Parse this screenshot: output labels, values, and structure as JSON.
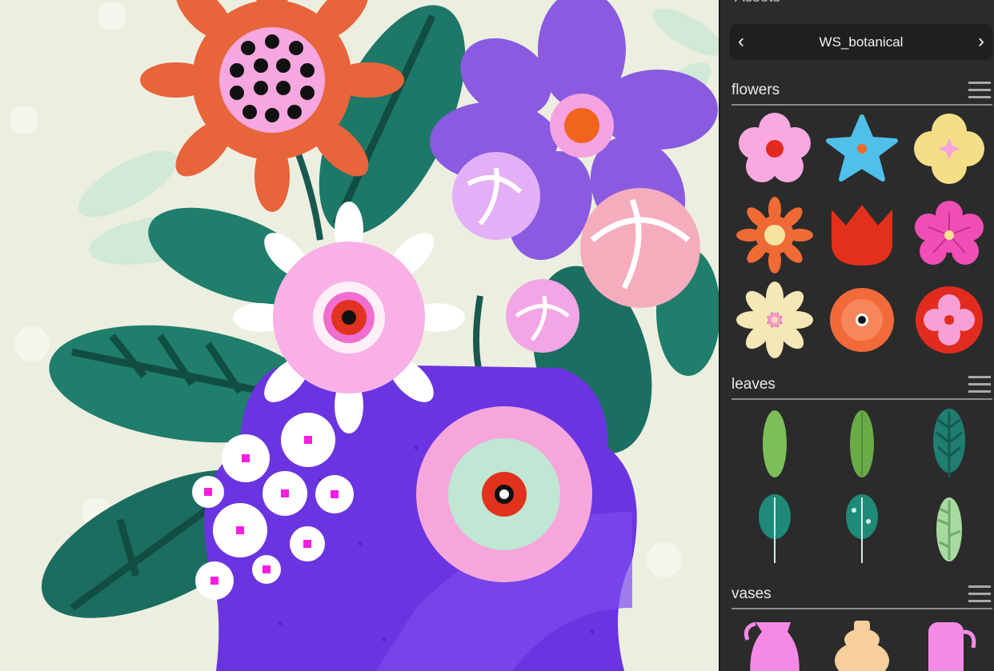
{
  "panel": {
    "title": "Assets",
    "library": {
      "name": "WS_botanical",
      "prev": "‹",
      "next": "›"
    },
    "sections": [
      {
        "title": "flowers",
        "items": [
          "pink-flower-icon",
          "blue-star-flower-icon",
          "yellow-clover-flower-icon",
          "orange-daisy-icon",
          "red-tulip-icon",
          "magenta-flower-icon",
          "cream-daisy-icon",
          "orange-dahlia-icon",
          "red-carnation-icon"
        ]
      },
      {
        "title": "leaves",
        "items": [
          "light-green-leaf-icon",
          "green-leaf-icon",
          "teal-veined-leaf-icon",
          "teal-stem-leaf-icon",
          "spotted-leaf-icon",
          "fern-leaf-icon"
        ]
      },
      {
        "title": "vases",
        "items": [
          "pink-jug-vase-icon",
          "peach-stacked-vase-icon",
          "pink-handle-vase-icon"
        ]
      }
    ]
  },
  "colors": {
    "panel_bg": "#2b2b2b",
    "canvas_bg": "#ecefe0",
    "vase_purple": "#6a35e0",
    "leaf_teal": "#1f7e6c"
  }
}
